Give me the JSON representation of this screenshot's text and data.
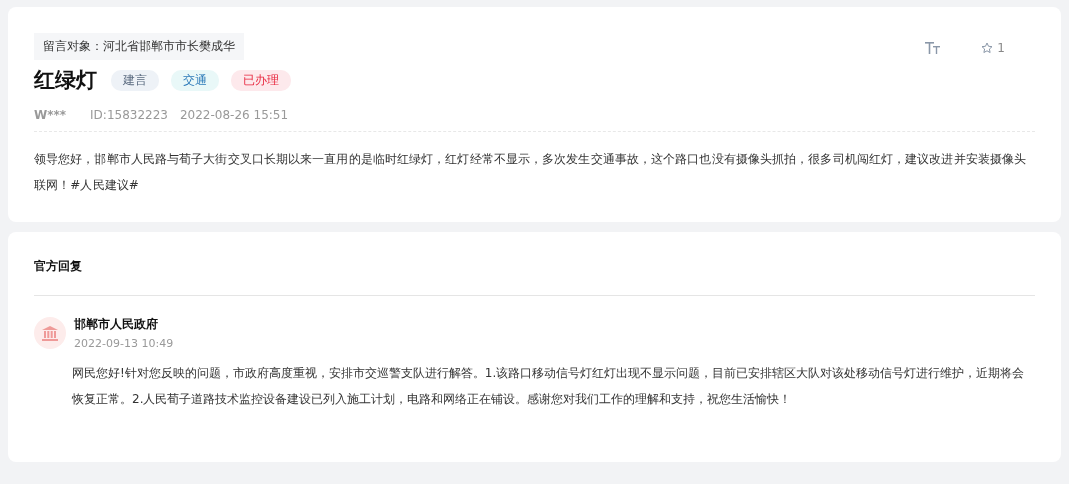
{
  "message": {
    "target": "留言对象：河北省邯郸市市长樊成华",
    "title": "红绿灯",
    "tags": [
      {
        "label": "建言",
        "kind": "type"
      },
      {
        "label": "交通",
        "kind": "field"
      },
      {
        "label": "已办理",
        "kind": "status"
      }
    ],
    "author": "W***",
    "id": "ID:15832223",
    "time": "2022-08-26 15:51",
    "favorites": "1",
    "body": "领导您好，邯郸市人民路与荀子大街交叉口长期以来一直用的是临时红绿灯，红灯经常不显示，多次发生交通事故，这个路口也没有摄像头抓拍，很多司机闯红灯，建议改进并安装摄像头联网！#人民建议#"
  },
  "reply": {
    "heading": "官方回复",
    "org": "邯郸市人民政府",
    "time": "2022-09-13 10:49",
    "body": "网民您好!针对您反映的问题，市政府高度重视，安排市交巡警支队进行解答。1.该路口移动信号灯红灯出现不显示问题，目前已安排辖区大队对该处移动信号灯进行维护，近期将会恢复正常。2.人民荀子道路技术监控设备建设已列入施工计划，电路和网络正在铺设。感谢您对我们工作的理解和支持，祝您生活愉快！"
  }
}
